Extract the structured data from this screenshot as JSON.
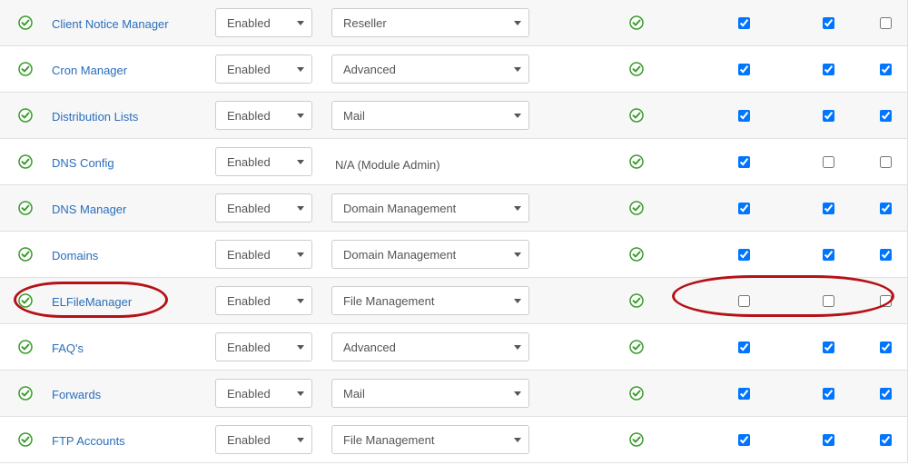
{
  "status_options_selected": "Enabled",
  "na_label": "N/A (Module Admin)",
  "rows": [
    {
      "name": "Client Notice Manager",
      "status": "Enabled",
      "category": "Reseller",
      "ok": true,
      "cb1": true,
      "cb2": true,
      "cb3": false
    },
    {
      "name": "Cron Manager",
      "status": "Enabled",
      "category": "Advanced",
      "ok": true,
      "cb1": true,
      "cb2": true,
      "cb3": true
    },
    {
      "name": "Distribution Lists",
      "status": "Enabled",
      "category": "Mail",
      "ok": true,
      "cb1": true,
      "cb2": true,
      "cb3": true
    },
    {
      "name": "DNS Config",
      "status": "Enabled",
      "category": "N/A (Module Admin)",
      "ok": true,
      "cb1": true,
      "cb2": false,
      "cb3": false
    },
    {
      "name": "DNS Manager",
      "status": "Enabled",
      "category": "Domain Management",
      "ok": true,
      "cb1": true,
      "cb2": true,
      "cb3": true
    },
    {
      "name": "Domains",
      "status": "Enabled",
      "category": "Domain Management",
      "ok": true,
      "cb1": true,
      "cb2": true,
      "cb3": true
    },
    {
      "name": "ELFileManager",
      "status": "Enabled",
      "category": "File Management",
      "ok": true,
      "cb1": false,
      "cb2": false,
      "cb3": false
    },
    {
      "name": "FAQ's",
      "status": "Enabled",
      "category": "Advanced",
      "ok": true,
      "cb1": true,
      "cb2": true,
      "cb3": true
    },
    {
      "name": "Forwards",
      "status": "Enabled",
      "category": "Mail",
      "ok": true,
      "cb1": true,
      "cb2": true,
      "cb3": true
    },
    {
      "name": "FTP Accounts",
      "status": "Enabled",
      "category": "File Management",
      "ok": true,
      "cb1": true,
      "cb2": true,
      "cb3": true
    }
  ]
}
